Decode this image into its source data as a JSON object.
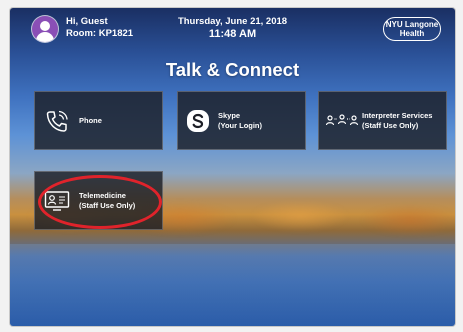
{
  "header": {
    "greeting": "Hi, Guest",
    "room": "Room: KP1821",
    "date": "Thursday, June 21, 2018",
    "time": "11:48 AM",
    "brand_line1": "NYU Langone",
    "brand_line2": "Health"
  },
  "page": {
    "title": "Talk & Connect"
  },
  "tiles": [
    {
      "label": "Phone",
      "icon": "phone-icon"
    },
    {
      "label": "Skype\n(Your Login)",
      "line1": "Skype",
      "line2": "(Your Login)",
      "icon": "skype-icon"
    },
    {
      "line1": "Interpreter Services",
      "line2": "(Staff Use Only)",
      "icon": "interpreter-icon"
    },
    {
      "line1": "Telemedicine",
      "line2": "(Staff Use Only)",
      "icon": "telemedicine-icon"
    }
  ],
  "colors": {
    "accent_highlight": "#e0232b",
    "tile_bg": "#1c1e26",
    "avatar": "#8a4fb6"
  }
}
